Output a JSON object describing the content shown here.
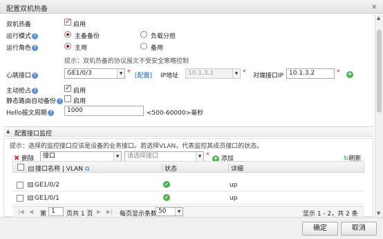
{
  "dialog": {
    "title": "配置双机热备",
    "close": "×"
  },
  "form": {
    "ha_label": "双机热备",
    "ha_enable_label": "启用",
    "run_mode_label": "运行模式",
    "run_mode_options": [
      "主备备份",
      "负载分担"
    ],
    "run_role_label": "运行角色",
    "run_role_options": [
      "主用",
      "备用"
    ],
    "hint": "提示：双机热备的协议报文不受安全策略控制",
    "heartbeat_label": "心跳接口",
    "heartbeat_value": "GE1/0/3",
    "config_link": "[配置]",
    "ip_label": "IP地址",
    "ip_value": "10.1.3.1",
    "peer_ip_label": "对端接口IP",
    "peer_ip_value": "10.1.3.2",
    "preempt_label": "主动抢占",
    "preempt_enable": "启用",
    "static_route_label": "静态路由自动备份",
    "static_route_enable": "启用",
    "hello_label": "Hello报文周期",
    "hello_value": "1000",
    "hello_range": "<500-60000>毫秒"
  },
  "monitor": {
    "title": "配置接口监控",
    "hint": "提示：选择的监控接口应该是设备的业务接口。若选择VLAN，代表监控其成员接口的状态。",
    "delete_label": "删除",
    "type_value": "接口",
    "select_placeholder": "请选择接口",
    "add_label": "添加",
    "refresh_label": "刷新",
    "columns": [
      "接口名称 | VLAN",
      "状态",
      "详细"
    ],
    "rows": [
      {
        "name": "GE1/0/2",
        "detail": "up"
      },
      {
        "name": "GE1/0/1",
        "detail": "up"
      }
    ],
    "pager": {
      "page_prefix": "第",
      "page_value": "1",
      "page_suffix": "页共 1 页",
      "per_page_label": "每页显示条数",
      "per_page_value": "50",
      "summary": "显示 1 - 2，共 2 条"
    }
  },
  "buttons": {
    "ok": "确定",
    "cancel": "取消"
  },
  "colors": {
    "accent_red": "#cc0000",
    "link_blue": "#1a5fb4",
    "ok_green": "#4caf50"
  }
}
